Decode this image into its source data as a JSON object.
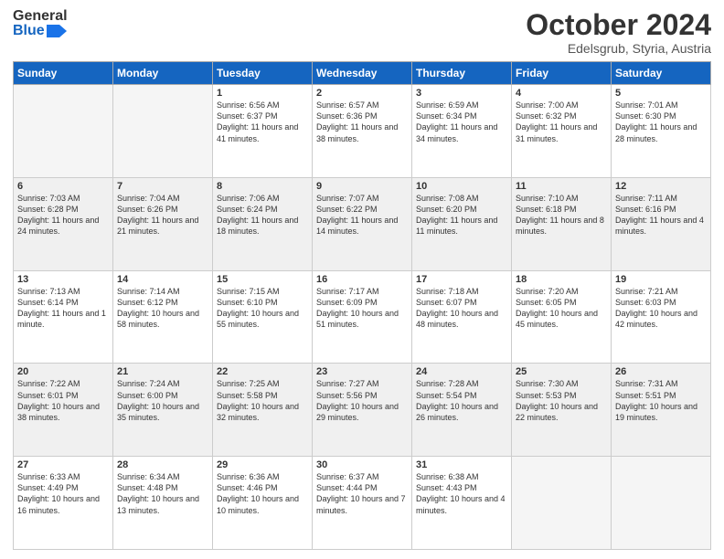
{
  "header": {
    "logo_general": "General",
    "logo_blue": "Blue",
    "title": "October 2024",
    "location": "Edelsgrub, Styria, Austria"
  },
  "days_of_week": [
    "Sunday",
    "Monday",
    "Tuesday",
    "Wednesday",
    "Thursday",
    "Friday",
    "Saturday"
  ],
  "weeks": [
    [
      {
        "day": null
      },
      {
        "day": null
      },
      {
        "day": "1",
        "sunrise": "Sunrise: 6:56 AM",
        "sunset": "Sunset: 6:37 PM",
        "daylight": "Daylight: 11 hours and 41 minutes."
      },
      {
        "day": "2",
        "sunrise": "Sunrise: 6:57 AM",
        "sunset": "Sunset: 6:36 PM",
        "daylight": "Daylight: 11 hours and 38 minutes."
      },
      {
        "day": "3",
        "sunrise": "Sunrise: 6:59 AM",
        "sunset": "Sunset: 6:34 PM",
        "daylight": "Daylight: 11 hours and 34 minutes."
      },
      {
        "day": "4",
        "sunrise": "Sunrise: 7:00 AM",
        "sunset": "Sunset: 6:32 PM",
        "daylight": "Daylight: 11 hours and 31 minutes."
      },
      {
        "day": "5",
        "sunrise": "Sunrise: 7:01 AM",
        "sunset": "Sunset: 6:30 PM",
        "daylight": "Daylight: 11 hours and 28 minutes."
      }
    ],
    [
      {
        "day": "6",
        "sunrise": "Sunrise: 7:03 AM",
        "sunset": "Sunset: 6:28 PM",
        "daylight": "Daylight: 11 hours and 24 minutes."
      },
      {
        "day": "7",
        "sunrise": "Sunrise: 7:04 AM",
        "sunset": "Sunset: 6:26 PM",
        "daylight": "Daylight: 11 hours and 21 minutes."
      },
      {
        "day": "8",
        "sunrise": "Sunrise: 7:06 AM",
        "sunset": "Sunset: 6:24 PM",
        "daylight": "Daylight: 11 hours and 18 minutes."
      },
      {
        "day": "9",
        "sunrise": "Sunrise: 7:07 AM",
        "sunset": "Sunset: 6:22 PM",
        "daylight": "Daylight: 11 hours and 14 minutes."
      },
      {
        "day": "10",
        "sunrise": "Sunrise: 7:08 AM",
        "sunset": "Sunset: 6:20 PM",
        "daylight": "Daylight: 11 hours and 11 minutes."
      },
      {
        "day": "11",
        "sunrise": "Sunrise: 7:10 AM",
        "sunset": "Sunset: 6:18 PM",
        "daylight": "Daylight: 11 hours and 8 minutes."
      },
      {
        "day": "12",
        "sunrise": "Sunrise: 7:11 AM",
        "sunset": "Sunset: 6:16 PM",
        "daylight": "Daylight: 11 hours and 4 minutes."
      }
    ],
    [
      {
        "day": "13",
        "sunrise": "Sunrise: 7:13 AM",
        "sunset": "Sunset: 6:14 PM",
        "daylight": "Daylight: 11 hours and 1 minute."
      },
      {
        "day": "14",
        "sunrise": "Sunrise: 7:14 AM",
        "sunset": "Sunset: 6:12 PM",
        "daylight": "Daylight: 10 hours and 58 minutes."
      },
      {
        "day": "15",
        "sunrise": "Sunrise: 7:15 AM",
        "sunset": "Sunset: 6:10 PM",
        "daylight": "Daylight: 10 hours and 55 minutes."
      },
      {
        "day": "16",
        "sunrise": "Sunrise: 7:17 AM",
        "sunset": "Sunset: 6:09 PM",
        "daylight": "Daylight: 10 hours and 51 minutes."
      },
      {
        "day": "17",
        "sunrise": "Sunrise: 7:18 AM",
        "sunset": "Sunset: 6:07 PM",
        "daylight": "Daylight: 10 hours and 48 minutes."
      },
      {
        "day": "18",
        "sunrise": "Sunrise: 7:20 AM",
        "sunset": "Sunset: 6:05 PM",
        "daylight": "Daylight: 10 hours and 45 minutes."
      },
      {
        "day": "19",
        "sunrise": "Sunrise: 7:21 AM",
        "sunset": "Sunset: 6:03 PM",
        "daylight": "Daylight: 10 hours and 42 minutes."
      }
    ],
    [
      {
        "day": "20",
        "sunrise": "Sunrise: 7:22 AM",
        "sunset": "Sunset: 6:01 PM",
        "daylight": "Daylight: 10 hours and 38 minutes."
      },
      {
        "day": "21",
        "sunrise": "Sunrise: 7:24 AM",
        "sunset": "Sunset: 6:00 PM",
        "daylight": "Daylight: 10 hours and 35 minutes."
      },
      {
        "day": "22",
        "sunrise": "Sunrise: 7:25 AM",
        "sunset": "Sunset: 5:58 PM",
        "daylight": "Daylight: 10 hours and 32 minutes."
      },
      {
        "day": "23",
        "sunrise": "Sunrise: 7:27 AM",
        "sunset": "Sunset: 5:56 PM",
        "daylight": "Daylight: 10 hours and 29 minutes."
      },
      {
        "day": "24",
        "sunrise": "Sunrise: 7:28 AM",
        "sunset": "Sunset: 5:54 PM",
        "daylight": "Daylight: 10 hours and 26 minutes."
      },
      {
        "day": "25",
        "sunrise": "Sunrise: 7:30 AM",
        "sunset": "Sunset: 5:53 PM",
        "daylight": "Daylight: 10 hours and 22 minutes."
      },
      {
        "day": "26",
        "sunrise": "Sunrise: 7:31 AM",
        "sunset": "Sunset: 5:51 PM",
        "daylight": "Daylight: 10 hours and 19 minutes."
      }
    ],
    [
      {
        "day": "27",
        "sunrise": "Sunrise: 6:33 AM",
        "sunset": "Sunset: 4:49 PM",
        "daylight": "Daylight: 10 hours and 16 minutes."
      },
      {
        "day": "28",
        "sunrise": "Sunrise: 6:34 AM",
        "sunset": "Sunset: 4:48 PM",
        "daylight": "Daylight: 10 hours and 13 minutes."
      },
      {
        "day": "29",
        "sunrise": "Sunrise: 6:36 AM",
        "sunset": "Sunset: 4:46 PM",
        "daylight": "Daylight: 10 hours and 10 minutes."
      },
      {
        "day": "30",
        "sunrise": "Sunrise: 6:37 AM",
        "sunset": "Sunset: 4:44 PM",
        "daylight": "Daylight: 10 hours and 7 minutes."
      },
      {
        "day": "31",
        "sunrise": "Sunrise: 6:38 AM",
        "sunset": "Sunset: 4:43 PM",
        "daylight": "Daylight: 10 hours and 4 minutes."
      },
      {
        "day": null
      },
      {
        "day": null
      }
    ]
  ]
}
